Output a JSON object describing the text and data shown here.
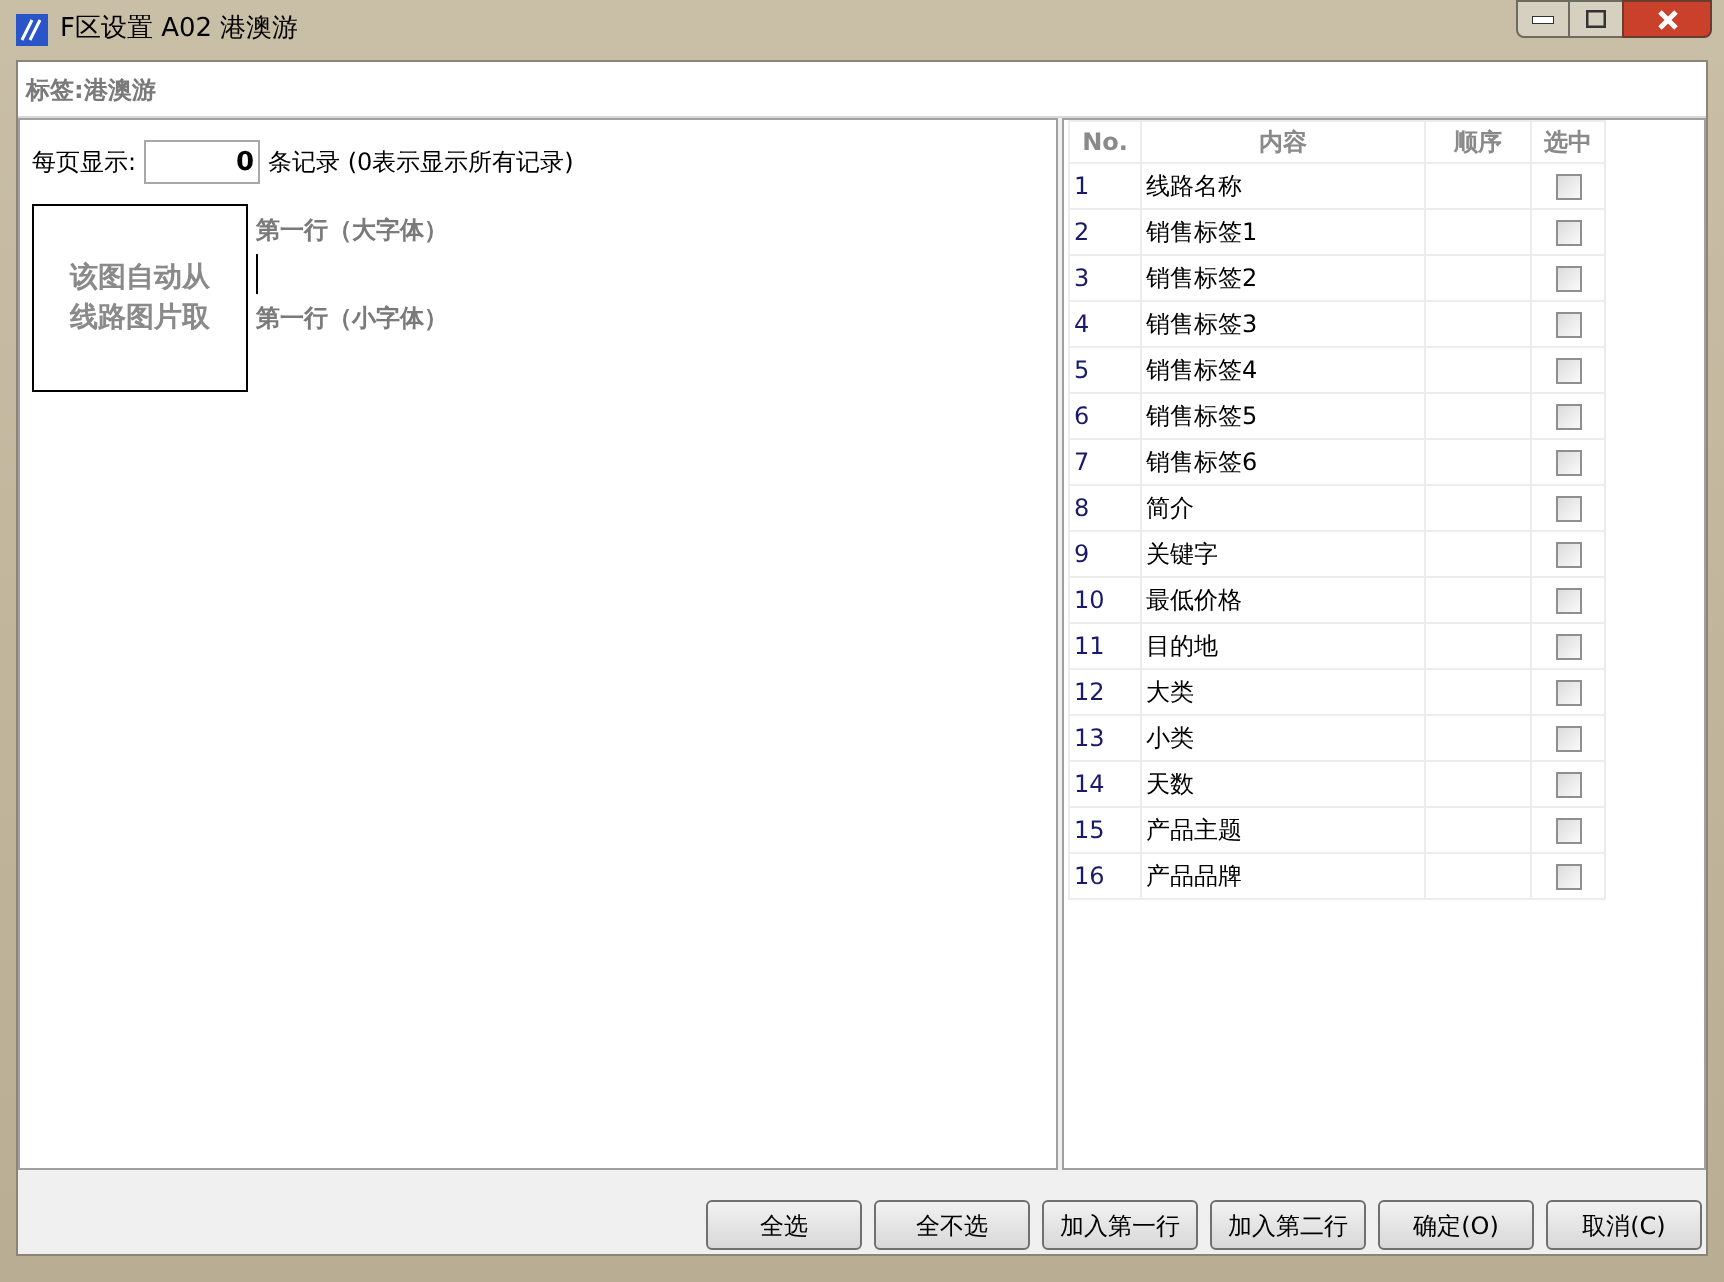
{
  "window": {
    "title": "F区设置 A02 港澳游"
  },
  "label_bar": {
    "text": "标签:港澳游"
  },
  "per_page": {
    "label": "每页显示:",
    "value": "0",
    "note": "条记录 (0表示显示所有记录)"
  },
  "image_box": {
    "text": "该图自动从线路图片取"
  },
  "preview": {
    "line_1": "第一行（大字体）",
    "line_2": "第一行（小字体）"
  },
  "table": {
    "columns": [
      "No.",
      "内容",
      "顺序",
      "选中"
    ],
    "rows": [
      {
        "no": "1",
        "content": "线路名称",
        "checked": false
      },
      {
        "no": "2",
        "content": "销售标签1",
        "checked": false
      },
      {
        "no": "3",
        "content": "销售标签2",
        "checked": false
      },
      {
        "no": "4",
        "content": "销售标签3",
        "checked": false
      },
      {
        "no": "5",
        "content": "销售标签4",
        "checked": false
      },
      {
        "no": "6",
        "content": "销售标签5",
        "checked": false
      },
      {
        "no": "7",
        "content": "销售标签6",
        "checked": false
      },
      {
        "no": "8",
        "content": "简介",
        "checked": false
      },
      {
        "no": "9",
        "content": "关键字",
        "checked": false
      },
      {
        "no": "10",
        "content": "最低价格",
        "checked": false
      },
      {
        "no": "11",
        "content": "目的地",
        "checked": false
      },
      {
        "no": "12",
        "content": "大类",
        "checked": false
      },
      {
        "no": "13",
        "content": "小类",
        "checked": false
      },
      {
        "no": "14",
        "content": "天数",
        "checked": false
      },
      {
        "no": "15",
        "content": "产品主题",
        "checked": false
      },
      {
        "no": "16",
        "content": "产品品牌",
        "checked": false
      }
    ]
  },
  "buttons": [
    "全选",
    "全不选",
    "加入第一行",
    "加入第二行",
    "确定(O)",
    "取消(C)"
  ]
}
